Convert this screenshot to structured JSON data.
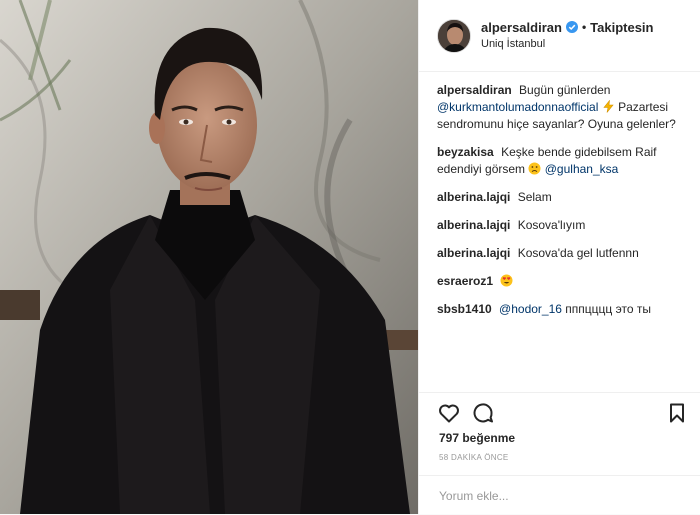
{
  "header": {
    "username": "alpersaldiran",
    "separator": "•",
    "follow_label": "Takiptesin",
    "location": "Uniq İstanbul"
  },
  "caption": {
    "username": "alpersaldiran",
    "text_before": "Bugün günlerden",
    "mention": "@kurkmantolumadonnaofficial",
    "emoji": "lightning-emoji",
    "text_after": "Pazartesi sendromunu hiçe sayanlar? Oyuna gelenler?"
  },
  "comments": [
    {
      "username": "beyzakisa",
      "text": "Keşke bende gidebilsem Raif edendiyi görsem",
      "emoji": "sad-face-emoji",
      "mention": "@gulhan_ksa"
    },
    {
      "username": "alberina.lajqi",
      "text": "Selam"
    },
    {
      "username": "alberina.lajqi",
      "text": "Kosova'lıyım"
    },
    {
      "username": "alberina.lajqi",
      "text": "Kosova'da gel lutfennn"
    },
    {
      "username": "esraeroz1",
      "emoji": "heart-eyes-emoji"
    },
    {
      "username": "sbsb1410",
      "mention": "@hodor_16",
      "text": "пппцццц это ты"
    }
  ],
  "actions": {
    "likes": "797 beğenme",
    "time_ago": "58 DAKİKA ÖNCE",
    "comment_placeholder": "Yorum ekle..."
  },
  "icons": {
    "like": "heart-icon",
    "comment": "comment-icon",
    "save": "bookmark-icon",
    "verified": "verified-badge-icon"
  },
  "colors": {
    "text": "#262626",
    "mention": "#003569",
    "muted": "#999999",
    "verified": "#3897f0",
    "border": "#efefef"
  }
}
